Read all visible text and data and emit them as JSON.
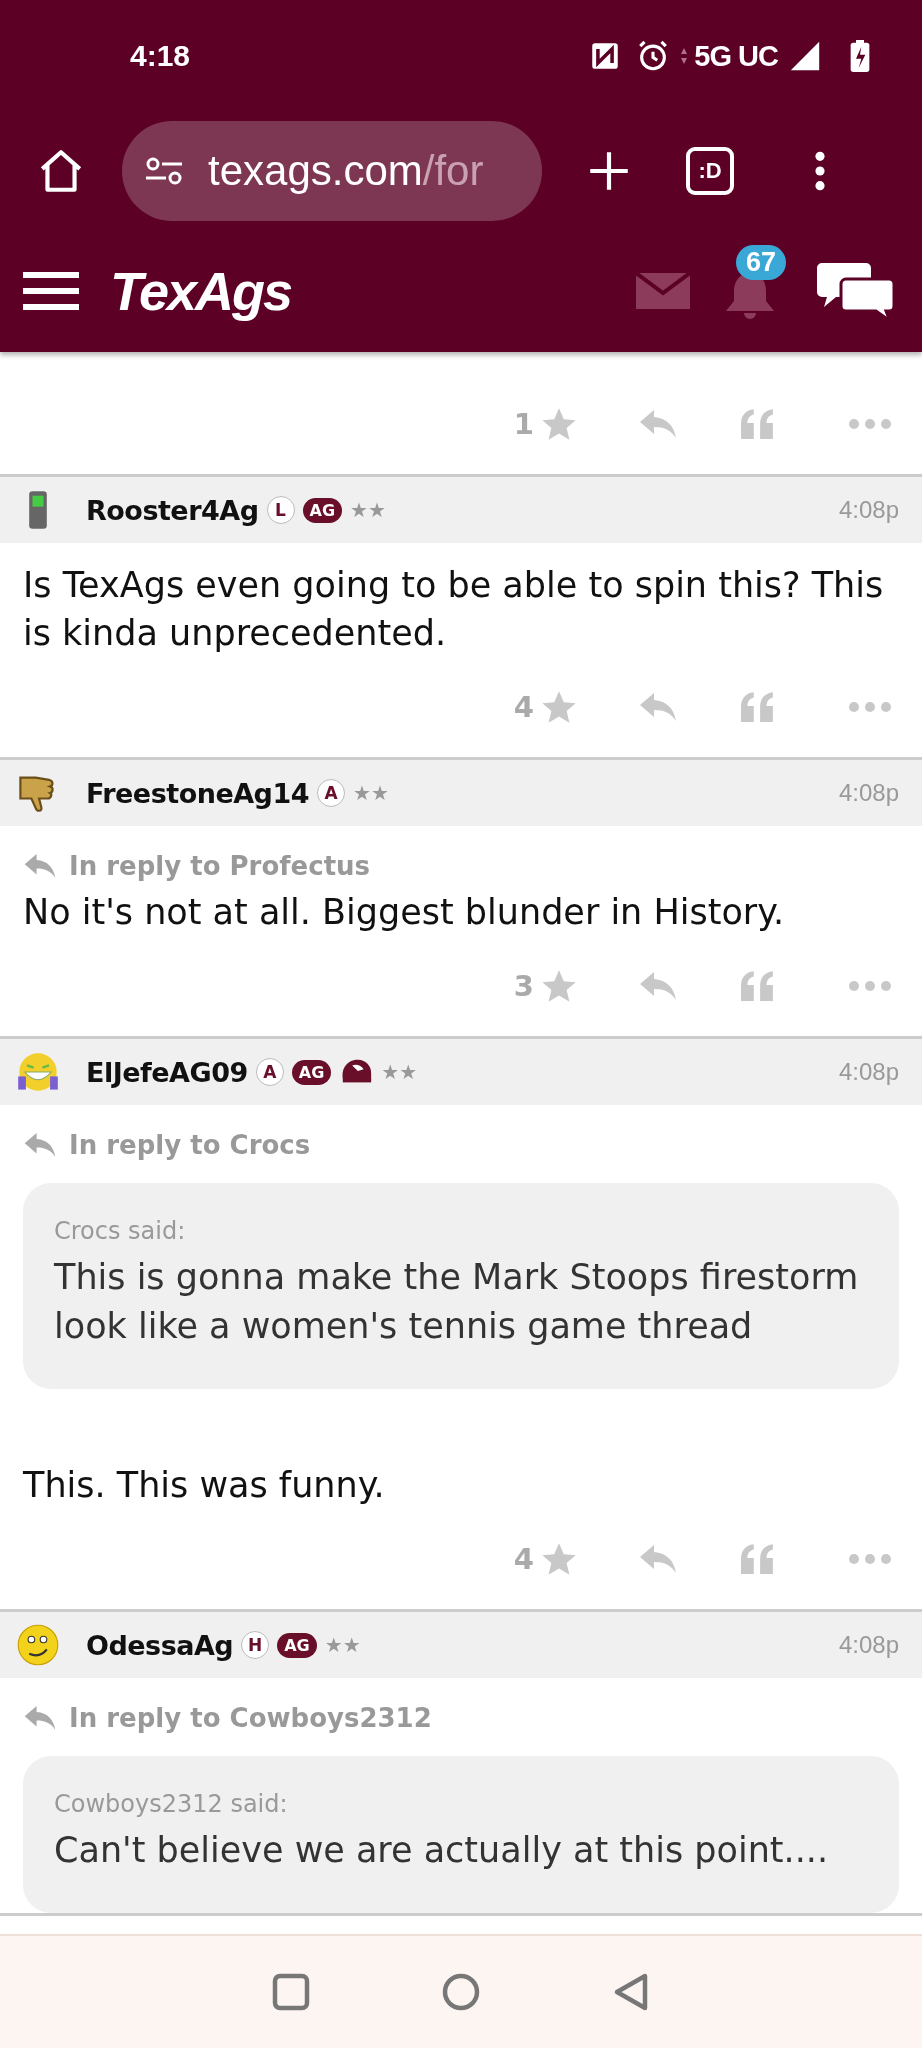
{
  "status_bar": {
    "time": "4:18",
    "network": "5G UC"
  },
  "browser": {
    "url_host": "texags.com",
    "url_path": "/for",
    "tab_count": ":D"
  },
  "nav": {
    "logo": "TexAgs",
    "notification_count": "67"
  },
  "top_post_actions": {
    "rating": "1",
    "starred": false
  },
  "posts": [
    {
      "avatar": {
        "kind": "phone"
      },
      "starred": false,
      "username": "Rooster4Ag",
      "badges": [
        {
          "kind": "letter",
          "text": "L"
        },
        {
          "kind": "ag",
          "text": "AG"
        }
      ],
      "rank": "★★",
      "time": "4:08p",
      "body": "Is TexAgs even going to be able to spin this? This is kinda unprecedented.",
      "rating": "4"
    },
    {
      "avatar": {
        "kind": "thumbs-down"
      },
      "starred": false,
      "username": "FreestoneAg14",
      "badges": [
        {
          "kind": "letter",
          "text": "A"
        }
      ],
      "rank": "★★",
      "time": "4:08p",
      "reply_to": "In reply to Profectus",
      "body": "No it's not at all. Biggest blunder in History.",
      "rating": "3"
    },
    {
      "avatar": {
        "kind": "laughing"
      },
      "starred": false,
      "username": "ElJefeAG09",
      "badges": [
        {
          "kind": "letter",
          "text": "A"
        },
        {
          "kind": "ag",
          "text": "AG"
        },
        {
          "kind": "helmet"
        }
      ],
      "rank": "★★",
      "time": "4:08p",
      "reply_to": "In reply to Crocs",
      "quote": {
        "author": "Crocs said:",
        "text": "This is gonna make the Mark Stoops firestorm look like a women's tennis game thread"
      },
      "body": "This. This was funny.",
      "rating": "4"
    },
    {
      "avatar": {
        "kind": "smile"
      },
      "username": "OdessaAg",
      "badges": [
        {
          "kind": "letter",
          "text": "H"
        },
        {
          "kind": "ag",
          "text": "AG"
        }
      ],
      "rank": "★★",
      "time": "4:08p",
      "reply_to": "In reply to Cowboys2312",
      "quote": {
        "author": "Cowboys2312 said:",
        "text": "Can't believe we are actually at this point...."
      }
    }
  ]
}
